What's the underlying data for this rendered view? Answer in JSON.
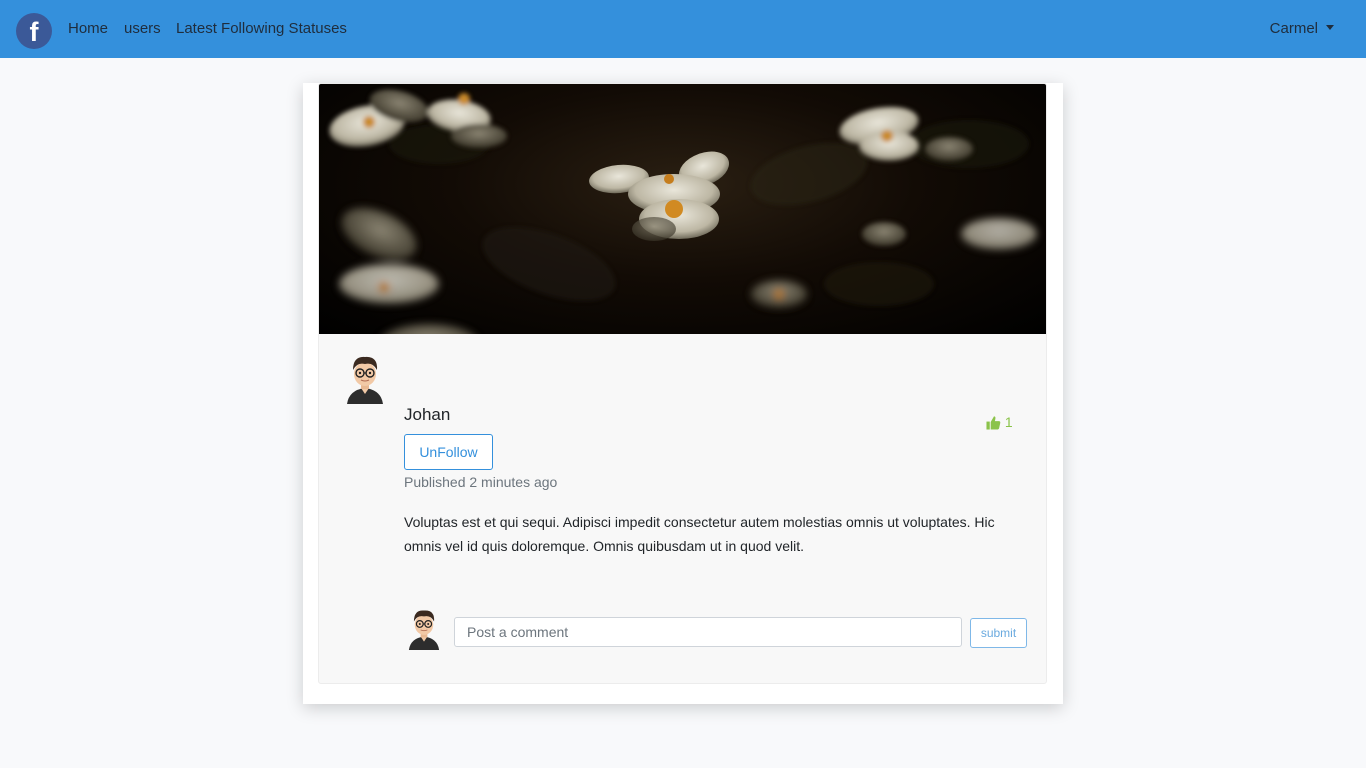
{
  "nav": {
    "logo_letter": "f",
    "links": [
      "Home",
      "users",
      "Latest Following Statuses"
    ],
    "user_name": "Carmel"
  },
  "post": {
    "author": "Johan",
    "follow_button": "UnFollow",
    "published": "Published 2 minutes ago",
    "like_count": "1",
    "body": "Voluptas est et qui sequi. Adipisci impedit consectetur autem molestias omnis ut voluptates. Hic omnis vel id quis doloremque. Omnis quibusdam ut in quod velit."
  },
  "comment": {
    "placeholder": "Post a comment",
    "submit_label": "submit"
  },
  "colors": {
    "navbar": "#3490dc",
    "like": "#8bc34a",
    "primary": "#3490dc"
  }
}
